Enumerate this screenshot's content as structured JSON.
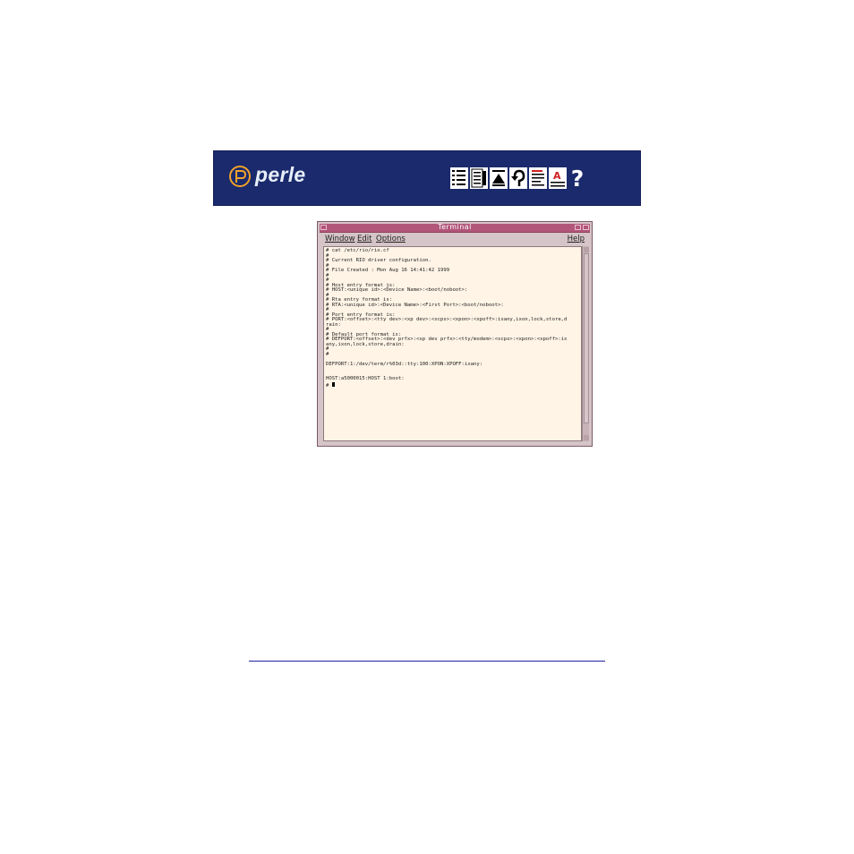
{
  "banner": {
    "brand": "perle",
    "background": "#1a2a6c",
    "nav_icons": [
      "contents-icon",
      "index-icon",
      "top-icon",
      "back-icon",
      "document-icon",
      "text-icon",
      "help-icon"
    ],
    "help_glyph": "?"
  },
  "terminal": {
    "title": "Terminal",
    "menu": {
      "window": "Window",
      "edit": "Edit",
      "options": "Options",
      "help": "Help"
    },
    "lines": [
      "# cat /etc/rio/rio.cf",
      "#",
      "# Current RIO driver configuration.",
      "#",
      "# File Created : Mon Aug 16 14:41:42 1999",
      "#",
      "#",
      "# Host entry format is:",
      "# HOST:<unique id>:<Device Name>:<boot/noboot>:",
      "#",
      "# Rta entry format is:",
      "# RTA:<unique id>:<Device Name>:<First Port>:<boot/noboot>:",
      "#",
      "# Port entry format is:",
      "# PORT:<offset>:<tty dev>:<xp dev>:<xcps>:<xpon>:<xpoff>:ixany,ixon,lock,store,d",
      "rain:",
      "#",
      "# Default port format is:",
      "# DEFPORT:<offset>:<dev prfx>:<xp dev prfx>:<tty/modem>:<xcps>:<xpon>:<xpoff>:ix",
      "any,ixon,lock,store,drain:",
      "#",
      "#",
      "",
      "DEFPORT:1:/dev/term/r%03d::tty:100:XPON:XPOFF:ixany:",
      "",
      "",
      "HOST:a5000015:HOST 1:boot:"
    ],
    "prompt": "# "
  }
}
